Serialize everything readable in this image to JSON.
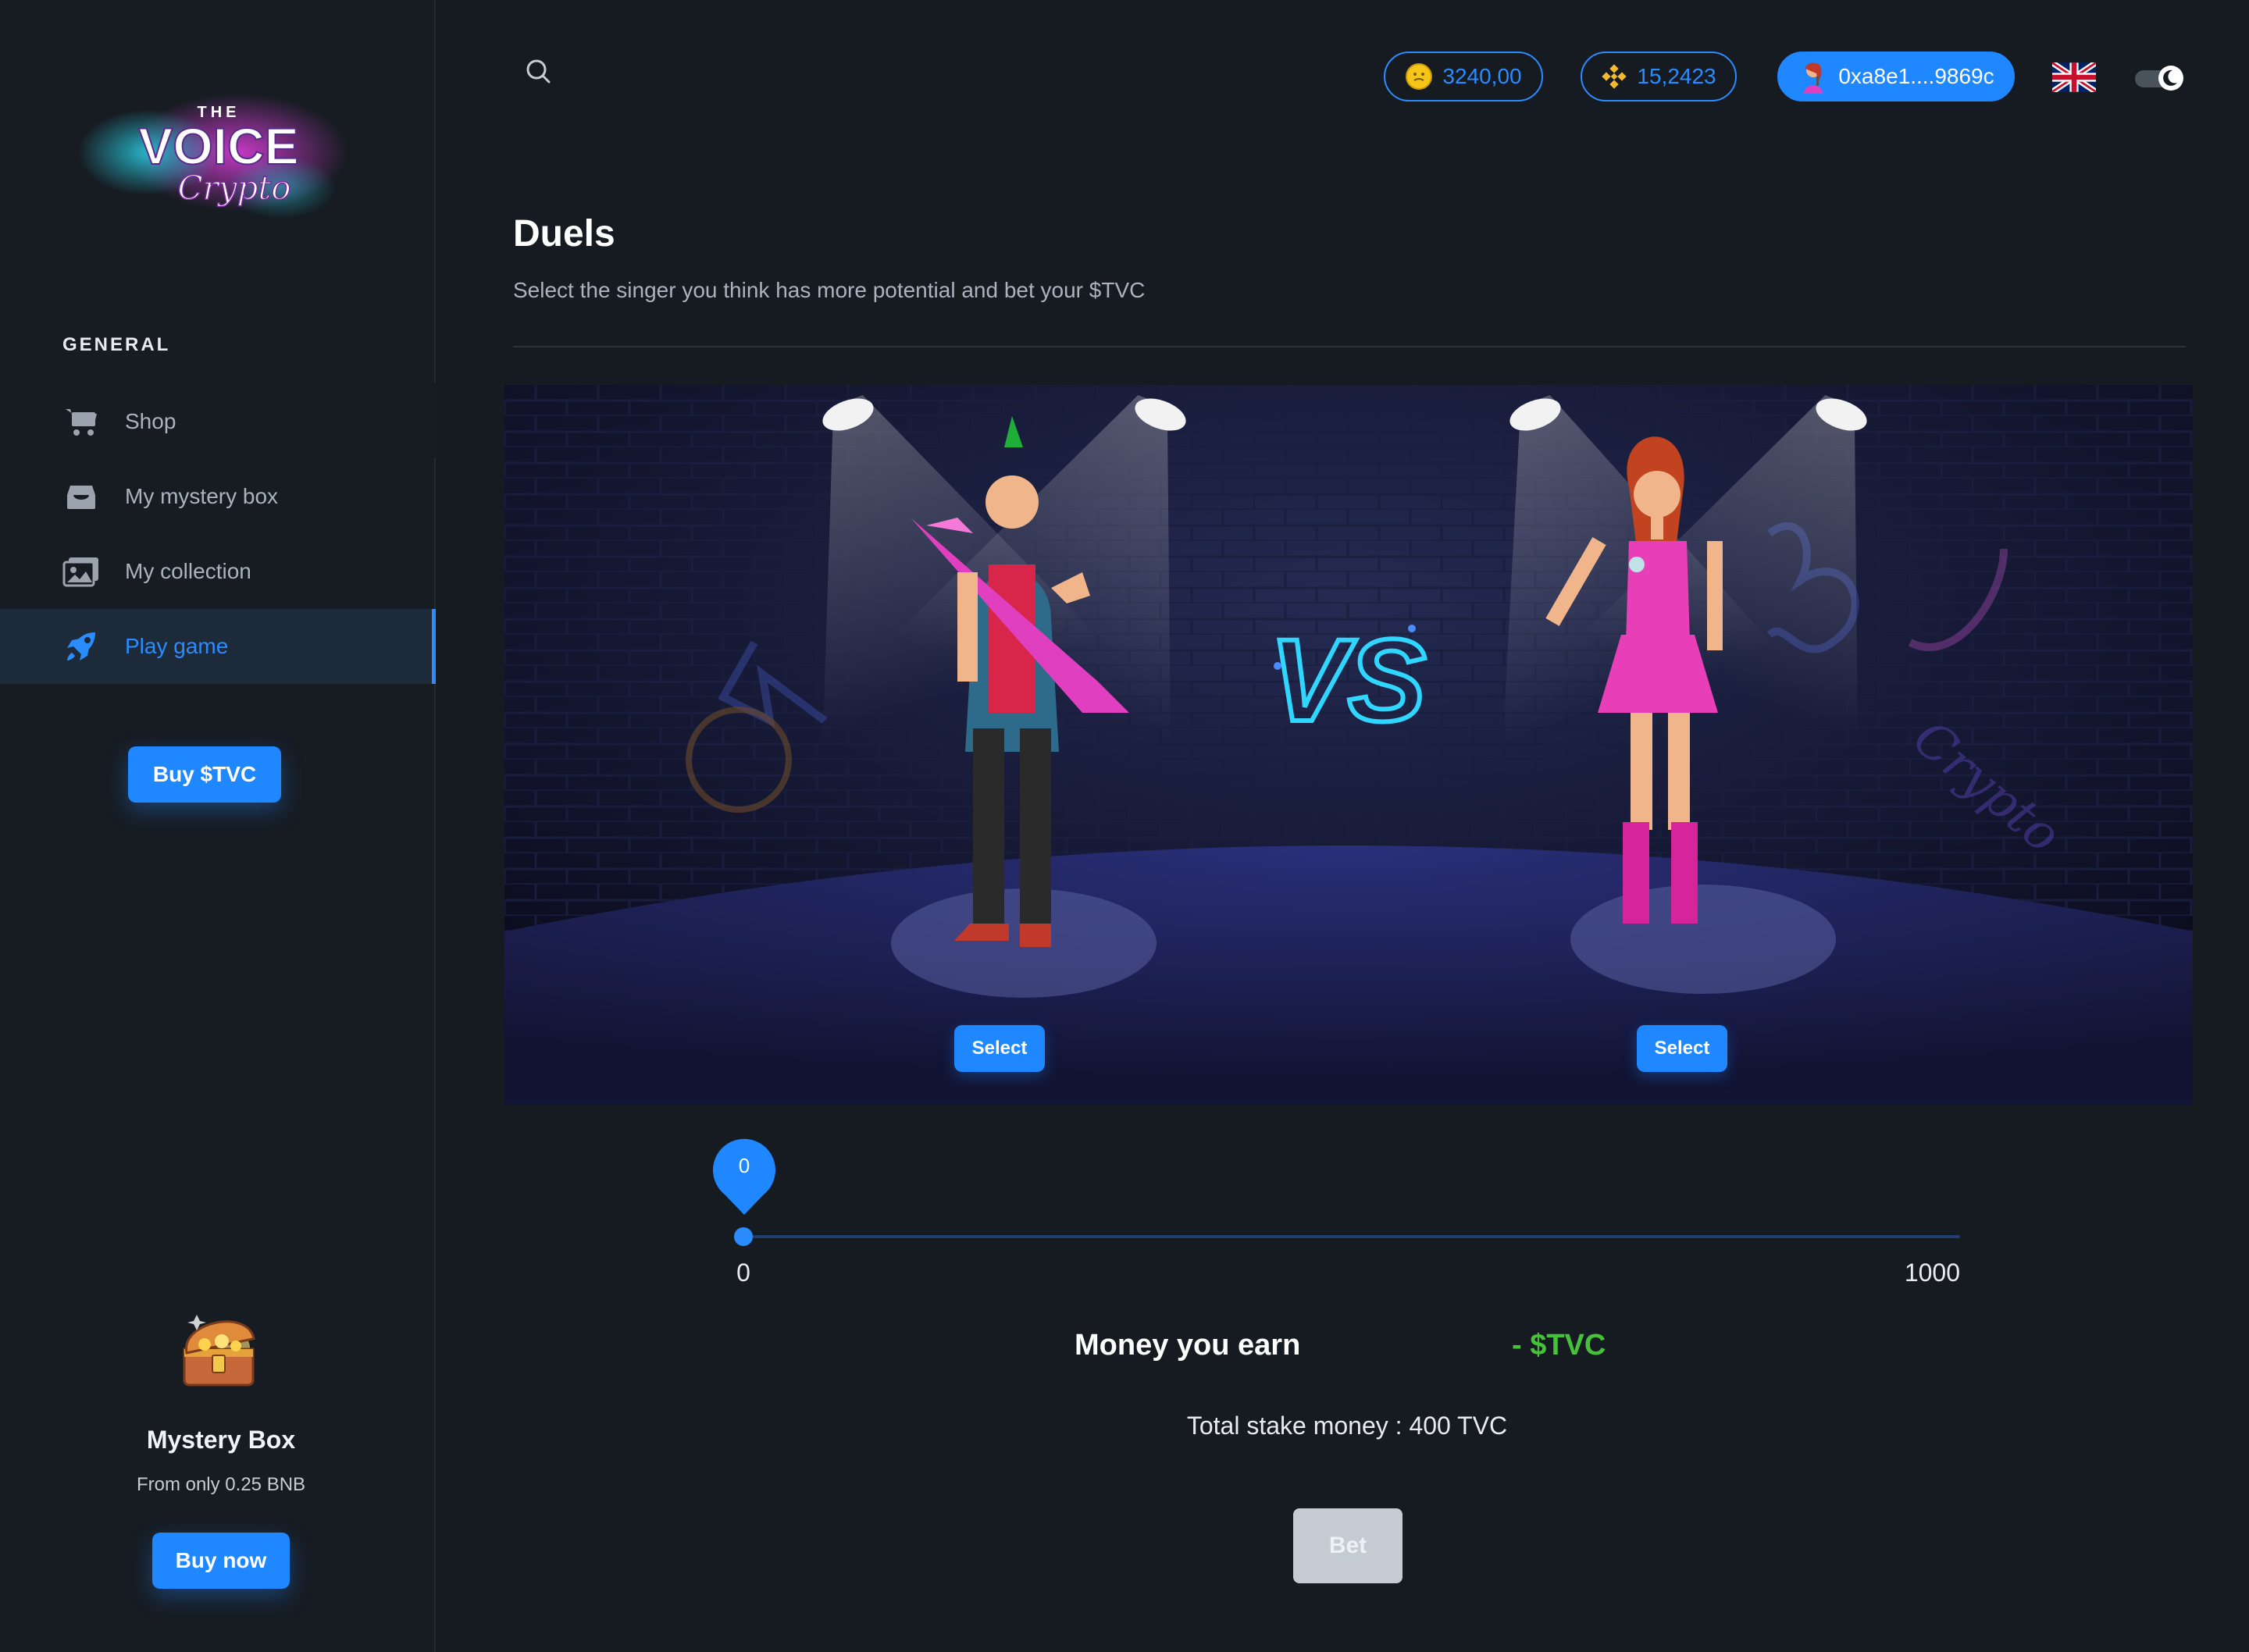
{
  "logo": {
    "top": "THE",
    "main": "VOICE",
    "script": "Crypto"
  },
  "sidebar": {
    "section_title": "GENERAL",
    "items": [
      {
        "label": "Shop",
        "icon": "cart-icon"
      },
      {
        "label": "My mystery box",
        "icon": "box-icon"
      },
      {
        "label": "My collection",
        "icon": "gallery-icon"
      },
      {
        "label": "Play game",
        "icon": "rocket-icon",
        "active": true
      }
    ],
    "buy_button": "Buy $TVC",
    "mystery": {
      "title": "Mystery Box",
      "subtitle": "From only 0.25 BNB",
      "button": "Buy now"
    }
  },
  "header": {
    "coins": "3240,00",
    "bnb": "15,2423",
    "wallet": "0xa8e1....9869c"
  },
  "main": {
    "title": "Duels",
    "subtitle": "Select the singer you think has more potential and bet your $TVC",
    "stage": {
      "vs": "VS",
      "select_left": "Select",
      "select_right": "Select"
    },
    "slider": {
      "value": "0",
      "min": "0",
      "max": "1000"
    },
    "earn_label": "Money you earn",
    "earn_value": "- $TVC",
    "stake": "Total stake money : 400 TVC",
    "bet_button": "Bet"
  },
  "colors": {
    "accent": "#1f87ff",
    "background": "#161b22",
    "earn_green": "#46c23a",
    "disabled": "#c5cbd3"
  }
}
